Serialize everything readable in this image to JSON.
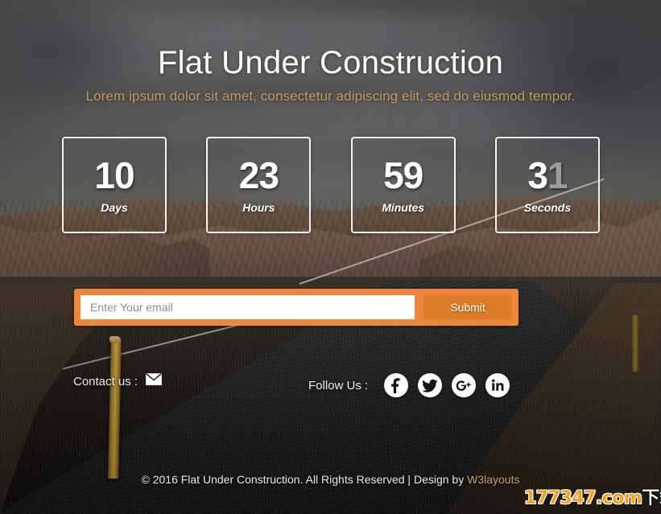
{
  "page": {
    "title": "Flat Under Construction",
    "subtitle": "Lorem ipsum dolor sit amet, consectetur adipiscing elit, sed do eiusmod tempor."
  },
  "countdown": {
    "items": [
      {
        "value": "10",
        "value_active": "10",
        "value_dim": "",
        "label": "Days"
      },
      {
        "value": "23",
        "value_active": "23",
        "value_dim": "",
        "label": "Hours"
      },
      {
        "value": "59",
        "value_active": "59",
        "value_dim": "",
        "label": "Minutes"
      },
      {
        "value": "31",
        "value_active": "3",
        "value_dim": "1",
        "label": "Seconds"
      }
    ]
  },
  "subscribe": {
    "placeholder": "Enter Your email",
    "value": "",
    "submit_label": "Submit",
    "bar_color": "#ef863b",
    "button_color": "#dd7a28"
  },
  "contact": {
    "label": "Contact us :",
    "icon": "envelope-icon"
  },
  "follow": {
    "label": "Follow Us :",
    "socials": [
      {
        "name": "facebook",
        "glyph": "f"
      },
      {
        "name": "twitter",
        "glyph": "t"
      },
      {
        "name": "google-plus",
        "glyph": "g+"
      },
      {
        "name": "linkedin",
        "glyph": "in"
      }
    ]
  },
  "footer": {
    "text_before": "© 2016 Flat Under Construction. All Rights Reserved | Design by ",
    "link_label": "W3layouts",
    "link_color": "#c9a257"
  },
  "watermark": {
    "part_orange": "177347.com",
    "part_white": "下载站"
  }
}
